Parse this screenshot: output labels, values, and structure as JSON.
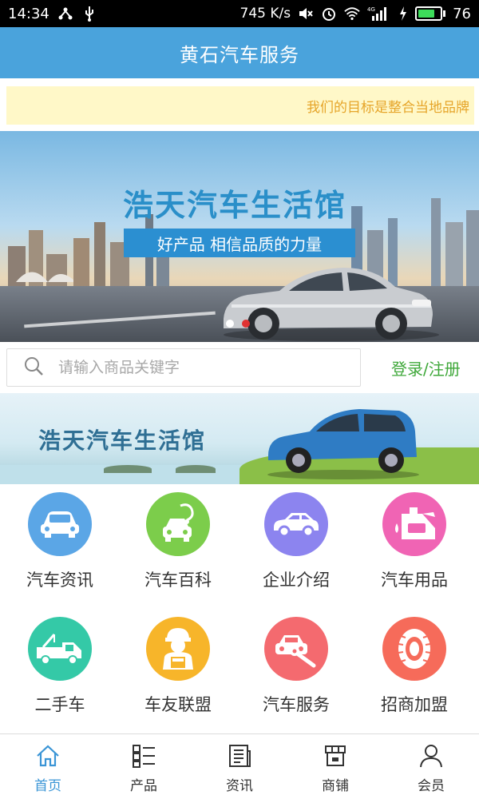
{
  "status_bar": {
    "time": "14:34",
    "net_speed": "745 K/s",
    "network": "4G",
    "battery_level": "76",
    "battery_fraction": 0.76
  },
  "header": {
    "title": "黄石汽车服务"
  },
  "notice": {
    "text": "我们的目标是整合当地品牌"
  },
  "banner": {
    "title": "浩天汽车生活馆",
    "slogan": "好产品 相信品质的力量",
    "slide_count": 2,
    "active_slide": 2
  },
  "search": {
    "placeholder": "请输入商品关键字",
    "login_label": "登录/注册"
  },
  "banner2": {
    "title": "浩天汽车生活馆"
  },
  "categories": [
    {
      "label": "汽车资讯",
      "icon": "car-front-icon",
      "color": "#5ba6e6"
    },
    {
      "label": "汽车百科",
      "icon": "car-stethoscope-icon",
      "color": "#7ccd4b"
    },
    {
      "label": "企业介绍",
      "icon": "car-side-icon",
      "color": "#8c84ef"
    },
    {
      "label": "汽车用品",
      "icon": "oil-can-icon",
      "color": "#f064b4"
    },
    {
      "label": "二手车",
      "icon": "tow-truck-icon",
      "color": "#34c9a7"
    },
    {
      "label": "车友联盟",
      "icon": "mechanic-icon",
      "color": "#f7b52a"
    },
    {
      "label": "汽车服务",
      "icon": "car-wrench-icon",
      "color": "#f46a6f"
    },
    {
      "label": "招商加盟",
      "icon": "tire-icon",
      "color": "#f66b5a"
    }
  ],
  "tabbar": {
    "items": [
      {
        "label": "首页",
        "icon": "home-icon",
        "active": true
      },
      {
        "label": "产品",
        "icon": "list-icon",
        "active": false
      },
      {
        "label": "资讯",
        "icon": "news-icon",
        "active": false
      },
      {
        "label": "商铺",
        "icon": "store-icon",
        "active": false
      },
      {
        "label": "会员",
        "icon": "user-icon",
        "active": false
      }
    ]
  }
}
